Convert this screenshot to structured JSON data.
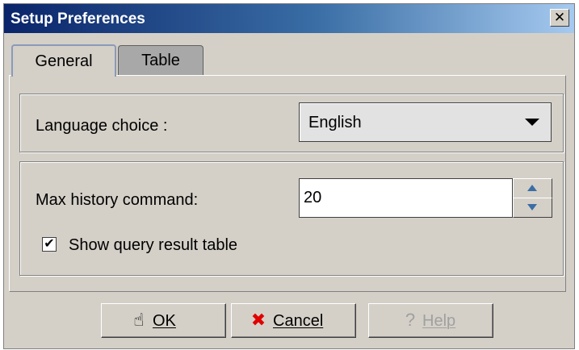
{
  "window": {
    "title": "Setup Preferences",
    "close_glyph": "✕"
  },
  "tabs": [
    {
      "label": "General",
      "selected": true
    },
    {
      "label": "Table",
      "selected": false
    }
  ],
  "general": {
    "language_label": "Language choice :",
    "language_value": "English",
    "history_label": "Max history command:",
    "history_value": "20",
    "show_result_label": "Show query result table",
    "show_result_checked": true,
    "check_glyph": "✔"
  },
  "buttons": {
    "ok": {
      "label": "OK",
      "icon": "hand-pointer-icon",
      "glyph": "☝"
    },
    "cancel": {
      "label": "Cancel",
      "icon": "red-x-icon",
      "glyph": "✖"
    },
    "help": {
      "label": "Help",
      "icon": "question-mark-icon",
      "glyph": "?",
      "enabled": false
    }
  },
  "colors": {
    "titlebar_start": "#0a246a",
    "titlebar_end": "#a6caf0",
    "window_bg": "#d4d0c8",
    "cancel_icon": "#e00000",
    "spinner_arrow": "#3a6ea5"
  }
}
